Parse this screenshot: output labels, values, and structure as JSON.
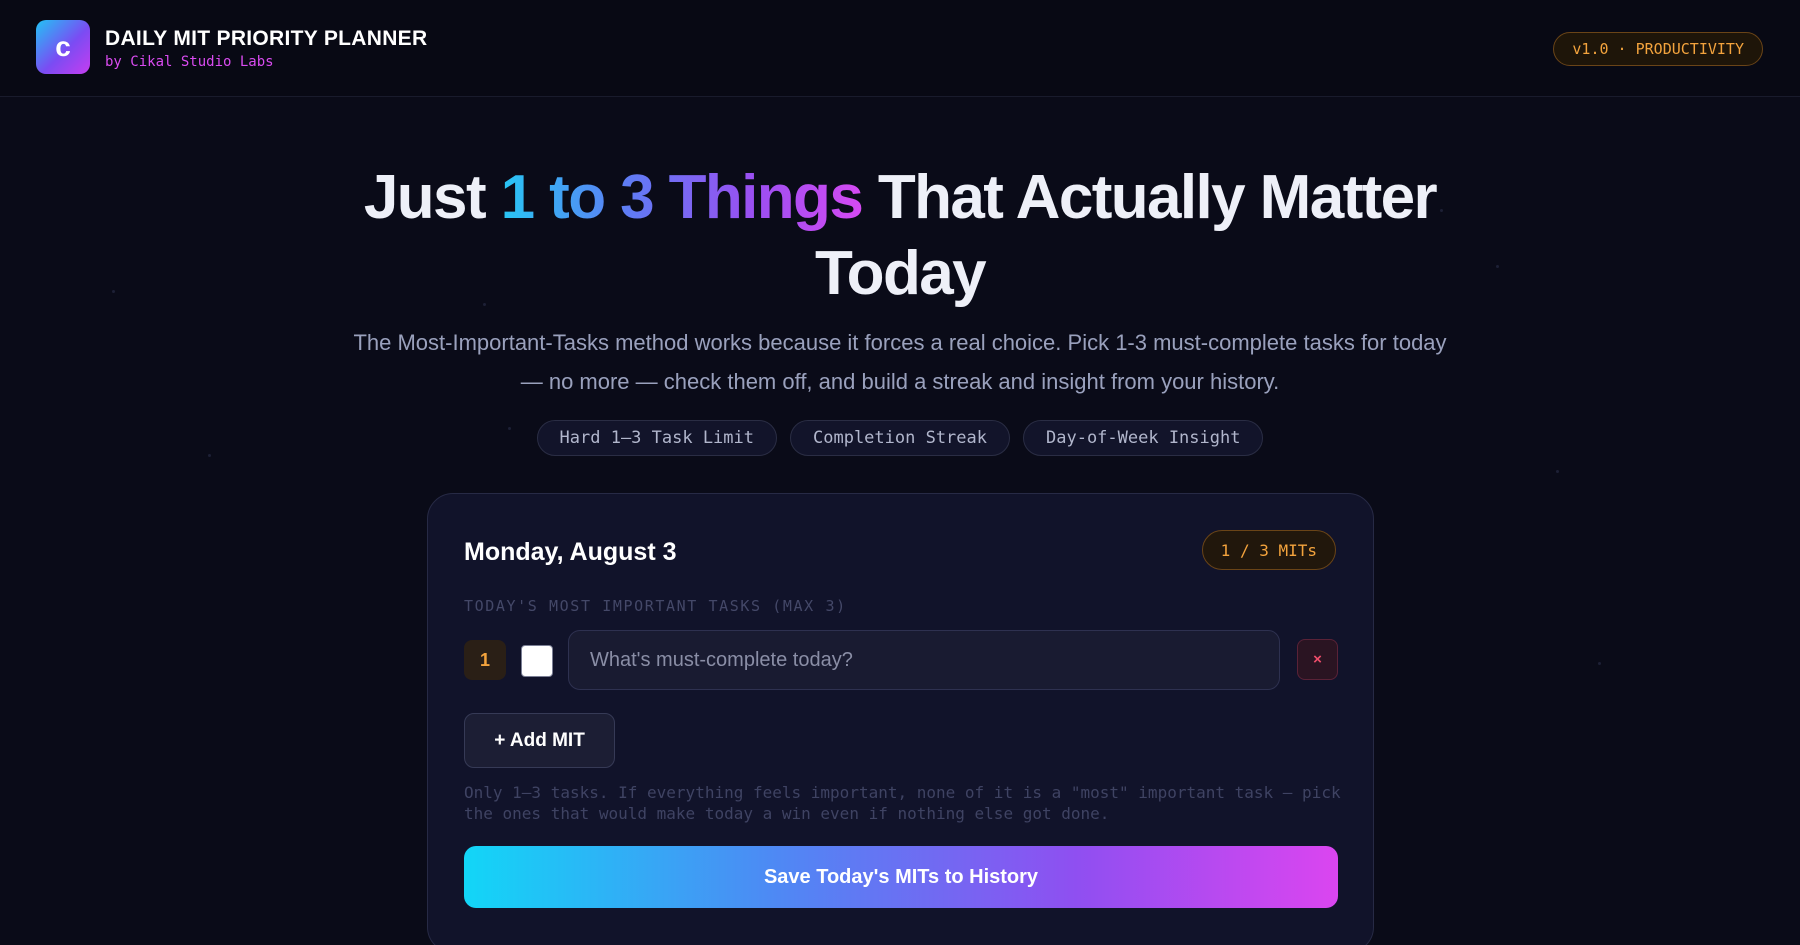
{
  "header": {
    "logo_letter": "c",
    "title": "DAILY MIT PRIORITY PLANNER",
    "subtitle": "by Cikal Studio Labs",
    "version_badge": "v1.0 · PRODUCTIVITY"
  },
  "hero": {
    "title_start": "Just",
    "title_highlight": "1 to 3 Things",
    "title_end": "That Actually Matter Today",
    "description": "The Most-Important-Tasks method works because it forces a real choice. Pick 1-3 must-complete tasks for today — no more — check them off, and build a streak and insight from your history.",
    "features": [
      "Hard 1–3 Task Limit",
      "Completion Streak",
      "Day-of-Week Insight"
    ]
  },
  "card": {
    "date": "Monday, August 3",
    "count_badge": "1 / 3 MITs",
    "section_label": "TODAY'S MOST IMPORTANT TASKS (MAX 3)",
    "tasks": [
      {
        "number": "1",
        "checked": false,
        "value": "",
        "placeholder": "What's must-complete today?",
        "remove_label": "×"
      }
    ],
    "add_button": "+ Add MIT",
    "hint": "Only 1–3 tasks. If everything feels important, none of it is a \"most\" important task — pick the ones that would make today a win even if nothing else got done.",
    "save_button": "Save Today's MITs to History"
  },
  "colors": {
    "background": "#0a0b18",
    "accent_orange": "#f3a33d",
    "accent_magenta": "#d94bf0",
    "accent_cyan": "#12d6f7",
    "danger": "#ef4d6b"
  }
}
